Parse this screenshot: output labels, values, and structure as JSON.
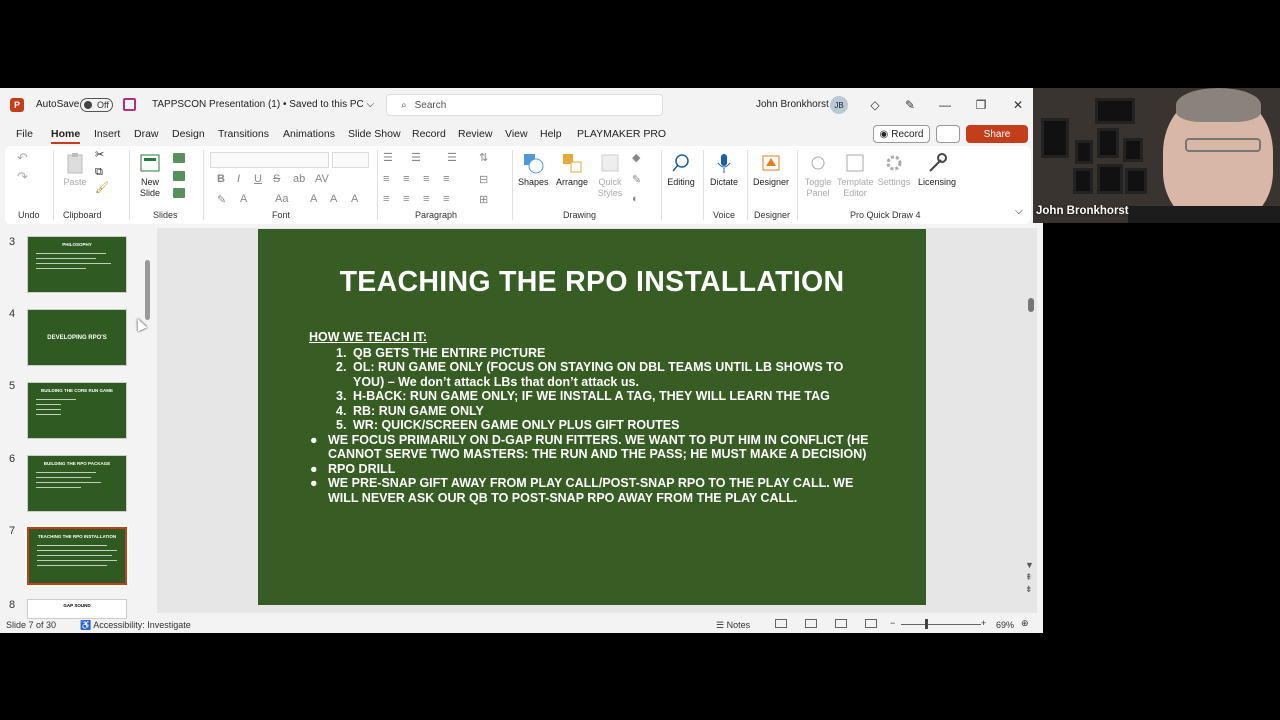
{
  "titlebar": {
    "autosave_label": "AutoSave",
    "autosave_state": "Off",
    "doc_title": "TAPPSCON Presentation (1) • Saved to this PC ⌵",
    "search_placeholder": "Search",
    "user_name": "John Bronkhorst",
    "user_initials": "JB"
  },
  "menu": {
    "tabs": [
      "File",
      "Home",
      "Insert",
      "Draw",
      "Design",
      "Transitions",
      "Animations",
      "Slide Show",
      "Record",
      "Review",
      "View",
      "Help",
      "PLAYMAKER PRO"
    ],
    "record_label": "Record",
    "share_label": "Share"
  },
  "ribbon": {
    "groups": [
      "Undo",
      "Clipboard",
      "Slides",
      "Font",
      "Paragraph",
      "Drawing",
      "Voice",
      "Designer",
      "Pro Quick Draw 4"
    ],
    "paste": "Paste",
    "new_slide": "New Slide",
    "shapes": "Shapes",
    "arrange": "Arrange",
    "quick_styles": "Quick Styles",
    "editing": "Editing",
    "dictate": "Dictate",
    "designer": "Designer",
    "toggle_panel": "Toggle Panel",
    "template_editor": "Template Editor",
    "settings": "Settings",
    "licensing": "Licensing"
  },
  "thumbnails": [
    {
      "num": "3",
      "title": "PHILOSOPHY"
    },
    {
      "num": "4",
      "title": "DEVELOPING RPO'S"
    },
    {
      "num": "5",
      "title": "BUILDING THE CORE RUN GAME"
    },
    {
      "num": "6",
      "title": "BUILDING THE RPO PACKAGE"
    },
    {
      "num": "7",
      "title": "TEACHING THE RPO INSTALLATION"
    },
    {
      "num": "8",
      "title": "GAP SOUND"
    }
  ],
  "slide": {
    "title": "TEACHING THE RPO INSTALLATION",
    "heading": "HOW WE TEACH IT:",
    "numbered": [
      {
        "n": "1.",
        "text": "QB GETS THE ENTIRE PICTURE"
      },
      {
        "n": "2.",
        "text": "OL: RUN GAME ONLY (FOCUS ON STAYING ON DBL TEAMS UNTIL LB SHOWS TO YOU) – We don’t attack LBs that don’t attack us."
      },
      {
        "n": "3.",
        "text": "H-BACK: RUN GAME ONLY; IF WE INSTALL A TAG, THEY WILL LEARN THE TAG"
      },
      {
        "n": "4.",
        "text": "RB: RUN GAME ONLY"
      },
      {
        "n": "5.",
        "text": "WR: QUICK/SCREEN GAME ONLY PLUS GIFT ROUTES"
      }
    ],
    "bullets": [
      "WE FOCUS PRIMARILY ON D-GAP RUN FITTERS. WE WANT TO PUT HIM IN CONFLICT (HE CANNOT SERVE TWO MASTERS: THE RUN AND THE PASS; HE MUST MAKE A DECISION)",
      "RPO DRILL",
      "WE PRE-SNAP GIFT AWAY FROM PLAY CALL/POST-SNAP RPO TO THE PLAY CALL. WE WILL NEVER ASK OUR QB TO POST-SNAP RPO AWAY FROM THE PLAY CALL."
    ]
  },
  "status": {
    "slide_of": "Slide 7 of 30",
    "accessibility": "Accessibility: Investigate",
    "notes": "Notes",
    "zoom": "69%"
  },
  "webcam": {
    "participant_name": "John Bronkhorst"
  },
  "colors": {
    "accent": "#c43e1c",
    "slide_bg": "#375d24"
  }
}
